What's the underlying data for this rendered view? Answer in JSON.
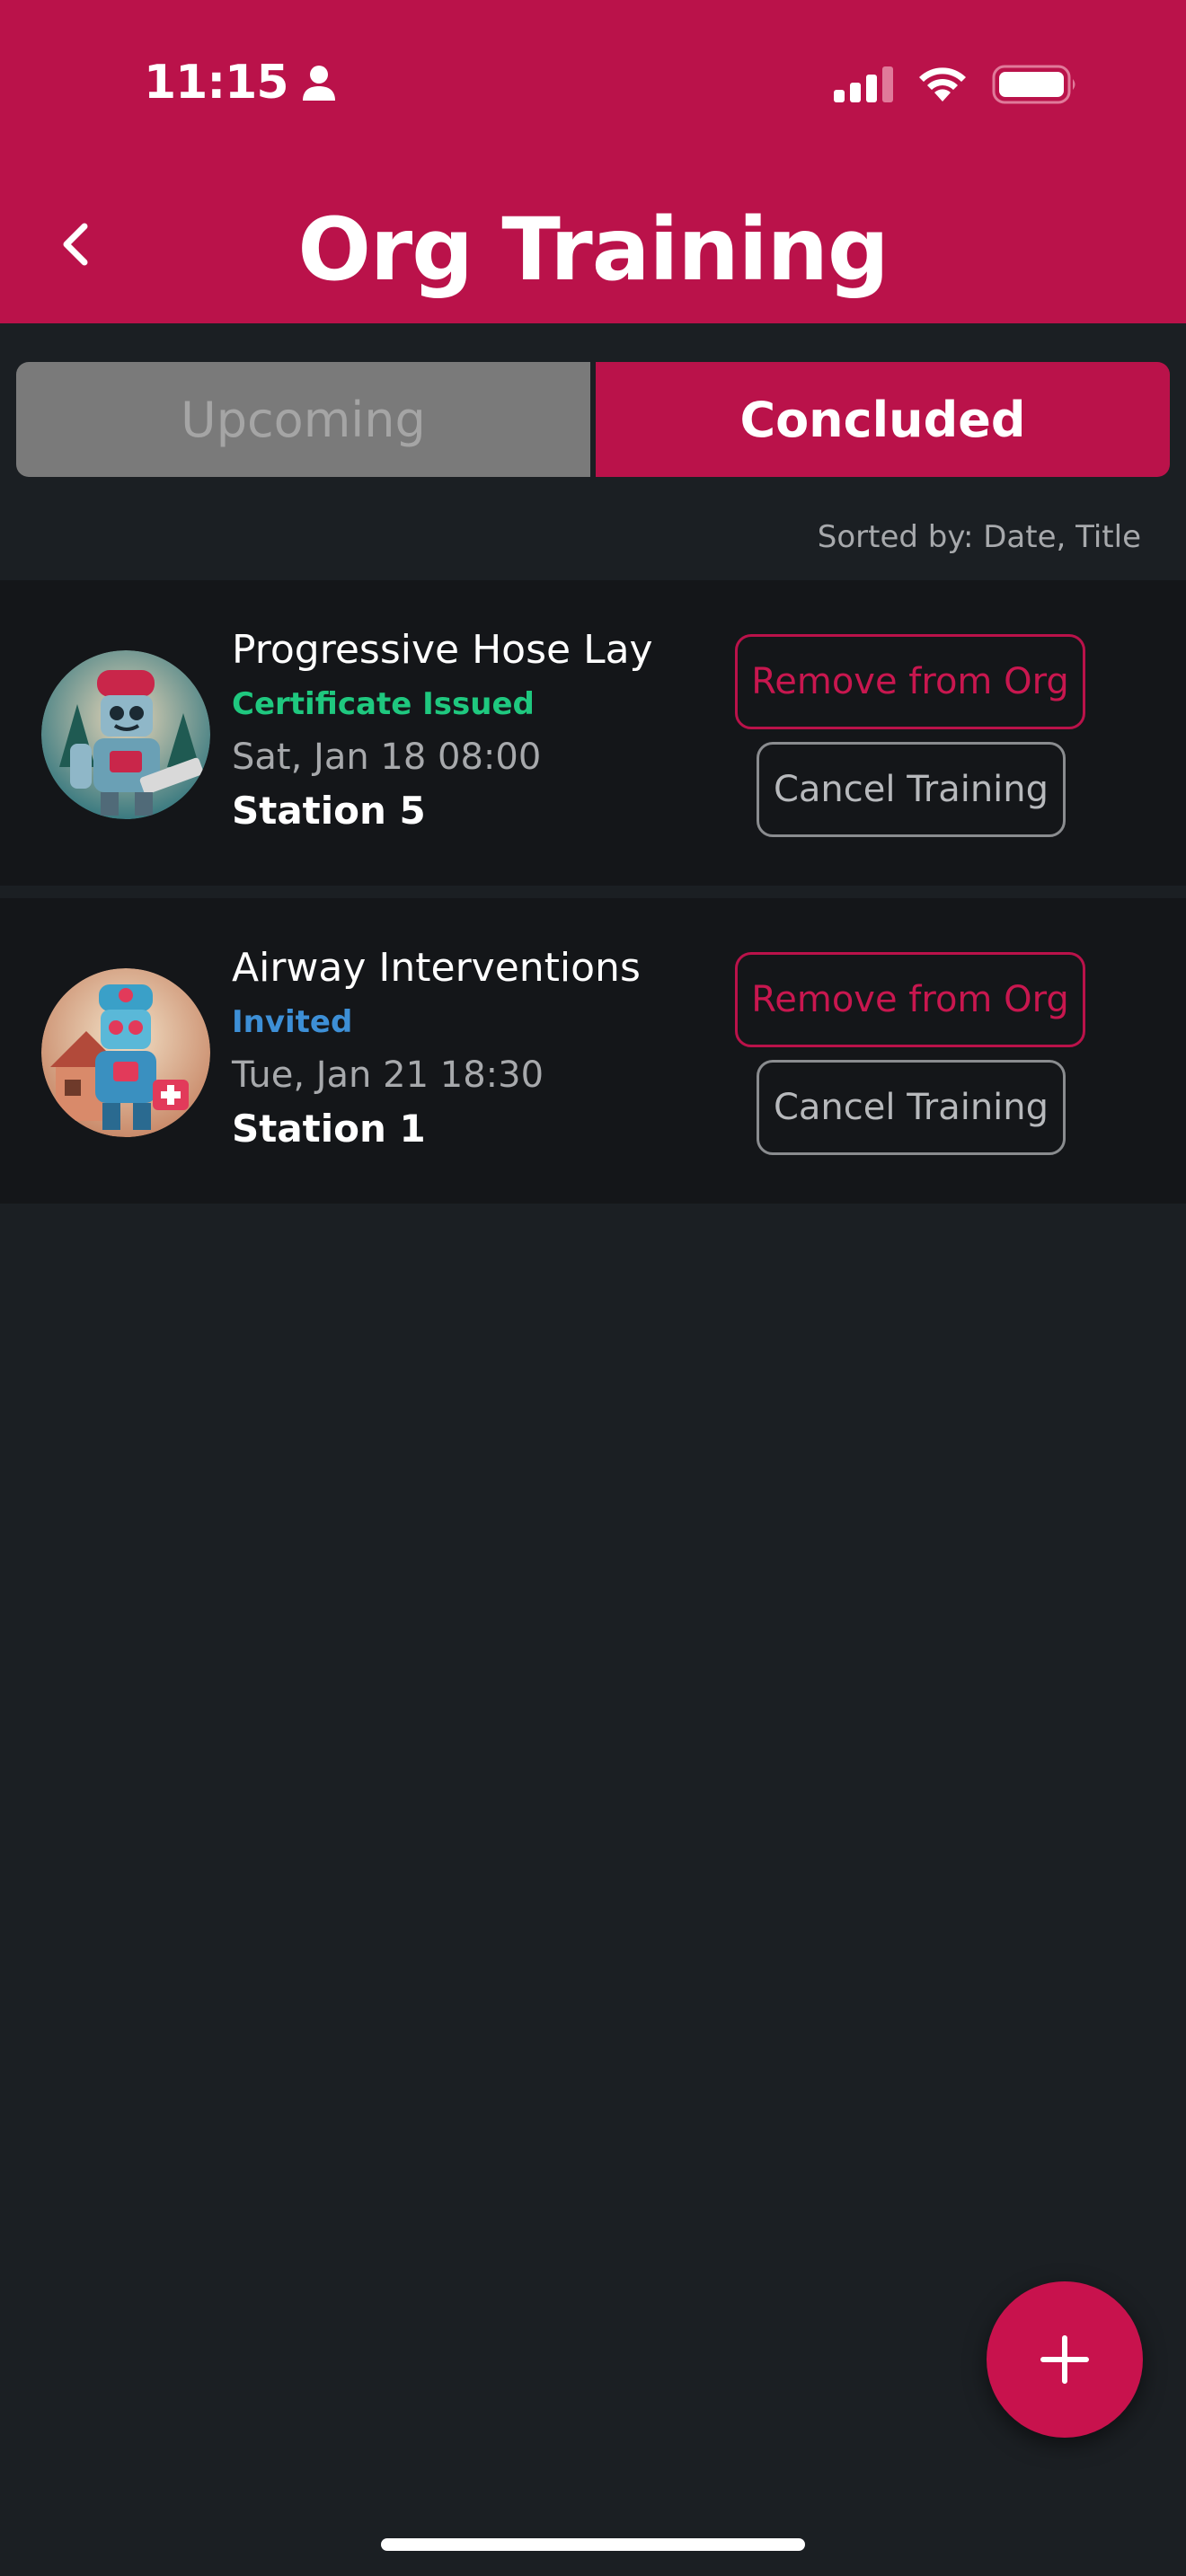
{
  "status_bar": {
    "time": "11:15"
  },
  "header": {
    "title": "Org Training"
  },
  "tabs": [
    {
      "label": "Upcoming",
      "active": false
    },
    {
      "label": "Concluded",
      "active": true
    }
  ],
  "sort_label": "Sorted by: Date, Title",
  "trainings": [
    {
      "title": "Progressive Hose Lay",
      "status": "Certificate Issued",
      "date": "Sat, Jan 18 08:00",
      "location": "Station 5",
      "remove_label": "Remove from Org",
      "cancel_label": "Cancel Training"
    },
    {
      "title": "Airway Interventions",
      "status": "Invited",
      "date": "Tue, Jan 21 18:30",
      "location": "Station 1",
      "remove_label": "Remove from Org",
      "cancel_label": "Cancel Training"
    }
  ],
  "colors": {
    "brand": "#ba124a",
    "background": "#1b1f23",
    "card": "#141619",
    "status_certificate": "#1fc87f",
    "status_invited": "#3d8fd6"
  },
  "icons": {
    "back": "chevron-left-icon",
    "add": "plus-icon",
    "person": "person-icon",
    "signal": "cellular-signal-icon",
    "wifi": "wifi-icon",
    "battery": "battery-icon"
  }
}
